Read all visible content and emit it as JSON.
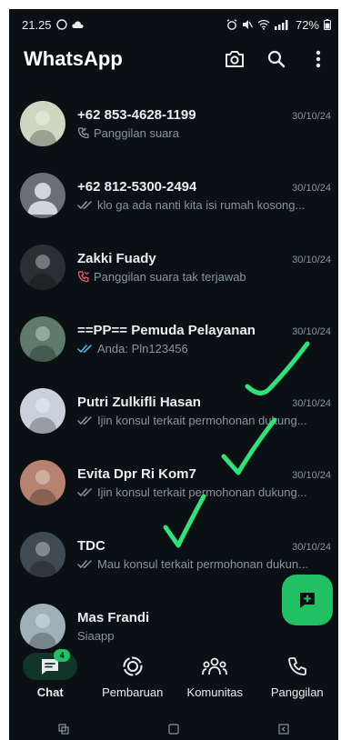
{
  "status": {
    "time": "21.25",
    "battery": "72%",
    "colors": {
      "text": "#e9edef"
    }
  },
  "app": {
    "title": "WhatsApp",
    "icons": [
      "camera-icon",
      "search-icon",
      "more-icon"
    ]
  },
  "chats": [
    {
      "name": "+62 853-4628-1199",
      "time": "30/10/24",
      "preview": "Panggilan suara",
      "status_icon": "incoming-call-icon",
      "avatar_color": "#cfd7c2"
    },
    {
      "name": "+62 812-5300-2494",
      "time": "30/10/24",
      "preview": "klo ga ada nanti kita isi rumah kosong...",
      "status_icon": "double-check-icon",
      "avatar_color": "#6a7175"
    },
    {
      "name": "Zakki Fuady",
      "time": "30/10/24",
      "preview": "Panggilan suara tak terjawab",
      "status_icon": "missed-call-icon",
      "avatar_color": "#2a2f33"
    },
    {
      "name": "==PP== Pemuda Pelayanan",
      "time": "30/10/24",
      "preview": "Anda: Pln123456",
      "status_icon": "double-check-blue-icon",
      "avatar_color": "#5e7a6a"
    },
    {
      "name": "Putri Zulkifli Hasan",
      "time": "30/10/24",
      "preview": "Ijin konsul terkait permohonan dukung...",
      "status_icon": "double-check-icon",
      "avatar_color": "#c9d2dc"
    },
    {
      "name": "Evita Dpr Ri Kom7",
      "time": "30/10/24",
      "preview": "Ijin konsul terkait permohonan dukung...",
      "status_icon": "double-check-icon",
      "avatar_color": "#b7826f"
    },
    {
      "name": "TDC",
      "time": "30/10/24",
      "preview": "Mau konsul terkait permohonan dukun...",
      "status_icon": "double-check-icon",
      "avatar_color": "#3f4a52"
    },
    {
      "name": "Mas Frandi",
      "time": "",
      "preview": "Siaapp",
      "status_icon": "",
      "avatar_color": "#9fb0b8"
    }
  ],
  "fab": {
    "icon": "new-chat-icon",
    "color": "#21c063"
  },
  "nav": [
    {
      "label": "Chat",
      "icon": "chat-icon",
      "active": true,
      "badge": "4"
    },
    {
      "label": "Pembaruan",
      "icon": "updates-icon",
      "active": false
    },
    {
      "label": "Komunitas",
      "icon": "communities-icon",
      "active": false
    },
    {
      "label": "Panggilan",
      "icon": "calls-icon",
      "active": false
    }
  ],
  "system_nav": [
    "recents-icon",
    "home-icon",
    "back-icon"
  ],
  "colors": {
    "background": "#0b1014",
    "accent": "#21c063",
    "secondary_text": "#8696a0",
    "annotation": "#2ee37a"
  }
}
